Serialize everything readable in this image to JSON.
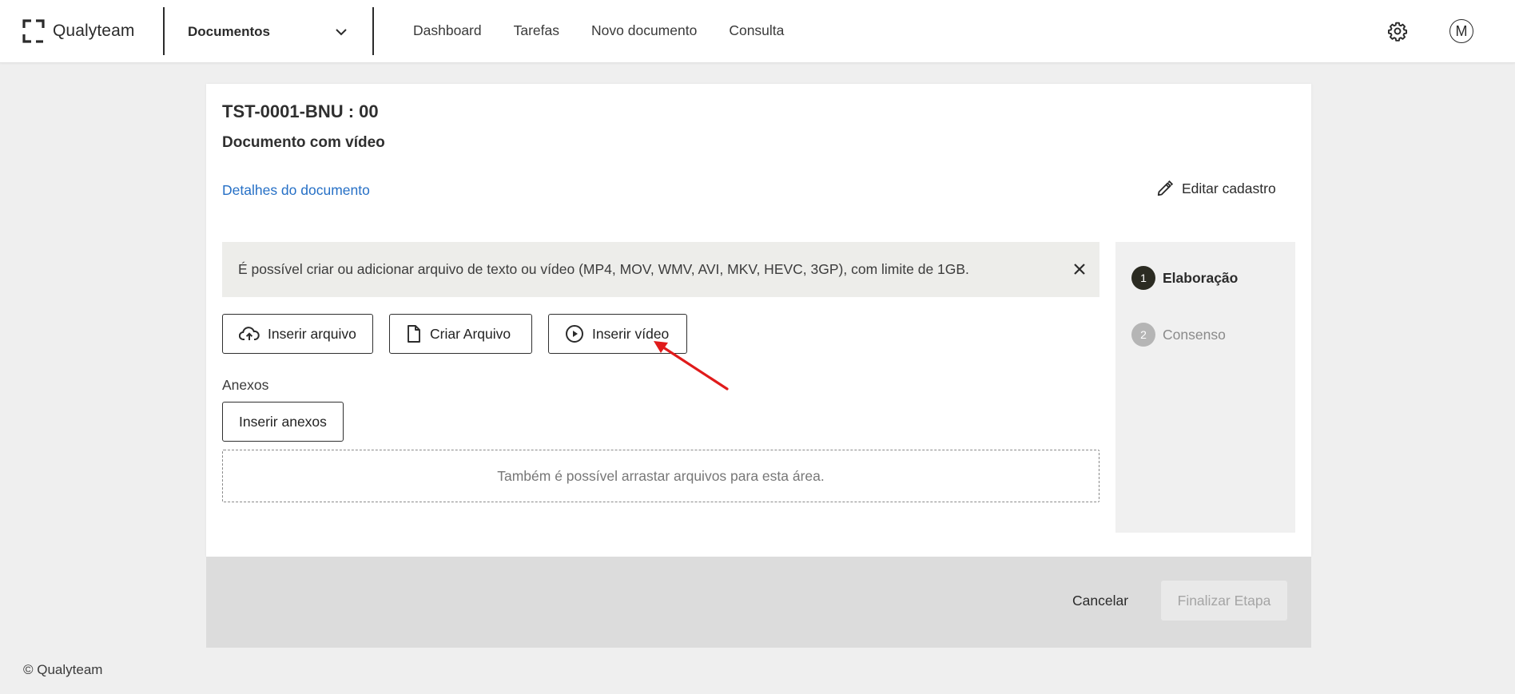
{
  "header": {
    "brand": "Qualyteam",
    "module_select": {
      "value": "Documentos"
    },
    "nav": [
      "Dashboard",
      "Tarefas",
      "Novo documento",
      "Consulta"
    ],
    "avatar_initial": "M",
    "icons": {
      "settings": "gear-icon",
      "dropdown": "chevron-down-icon"
    }
  },
  "document": {
    "code": "TST-0001-BNU : 00",
    "title": "Documento com vídeo",
    "details_link": "Detalhes do documento",
    "edit_label": "Editar cadastro"
  },
  "banner": {
    "text": "É possível criar ou adicionar arquivo de texto ou vídeo (MP4, MOV, WMV, AVI, MKV, HEVC, 3GP), com limite de 1GB."
  },
  "actions": {
    "insert_file": "Inserir arquivo",
    "create_file": "Criar Arquivo",
    "insert_video": "Inserir vídeo"
  },
  "attachments": {
    "label": "Anexos",
    "button": "Inserir anexos",
    "dropzone": "Também é possível arrastar arquivos para esta área."
  },
  "steps": [
    {
      "number": "1",
      "label": "Elaboração",
      "active": true
    },
    {
      "number": "2",
      "label": "Consenso",
      "active": false
    }
  ],
  "footer_actions": {
    "cancel": "Cancelar",
    "finish": "Finalizar Etapa"
  },
  "copyright": "© Qualyteam",
  "colors": {
    "link": "#2670c6",
    "active_step": "#2b2b22",
    "inactive_step": "#b5b5b5",
    "annotation_arrow": "#e01b1b"
  }
}
